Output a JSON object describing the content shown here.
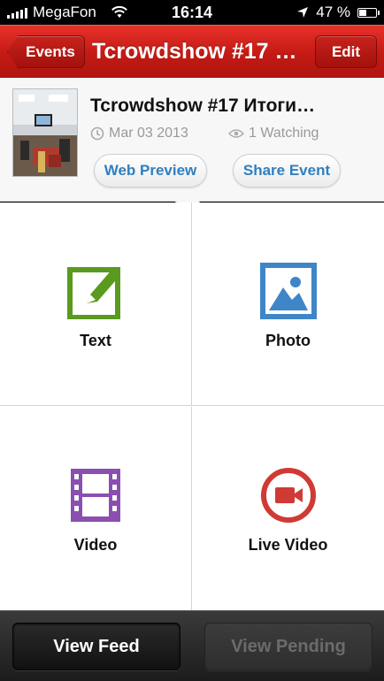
{
  "status_bar": {
    "carrier": "MegaFon",
    "time": "16:14",
    "battery": "47 %",
    "battery_level": 0.47,
    "icons": [
      "signal-icon",
      "wifi-icon",
      "location-arrow-icon",
      "battery-icon"
    ]
  },
  "nav": {
    "back_label": "Events",
    "title": "Tcrowdshow #17 Итоги…",
    "edit_label": "Edit"
  },
  "event": {
    "title": "Tcrowdshow #17 Итоги…",
    "date": "Mar 03 2013",
    "watching": "1 Watching",
    "web_preview_label": "Web Preview",
    "share_label": "Share Event"
  },
  "actions": [
    {
      "label": "Text",
      "icon": "pencil-square-icon",
      "color": "#5a9a1e"
    },
    {
      "label": "Photo",
      "icon": "image-icon",
      "color": "#3f86c8"
    },
    {
      "label": "Video",
      "icon": "film-strip-icon",
      "color": "#8a4fb0"
    },
    {
      "label": "Live Video",
      "icon": "video-camera-icon",
      "color": "#d03a35"
    }
  ],
  "bottom": {
    "view_feed": "View Feed",
    "view_pending": "View Pending"
  },
  "colors": {
    "nav_red": "#c41a14",
    "link_blue": "#2f7fc0"
  }
}
